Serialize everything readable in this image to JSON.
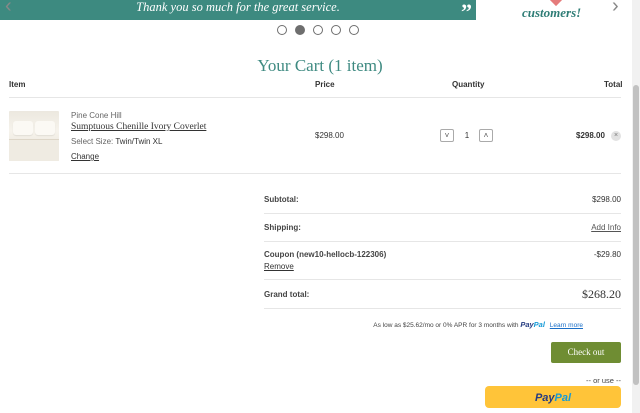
{
  "carousel": {
    "banner_text": "Thank you so much for the great service.",
    "quote_mark": "”",
    "side_text": "customers!",
    "prev_icon": "‹",
    "next_icon": "›",
    "slide_count": 5,
    "active_slide": 2
  },
  "cart": {
    "title": "Your Cart (1 item)",
    "headers": {
      "item": "Item",
      "price": "Price",
      "quantity": "Quantity",
      "total": "Total"
    },
    "item": {
      "brand": "Pine Cone Hill",
      "name": "Sumptuous Chenille Ivory Coverlet",
      "size_label": "Select Size:",
      "size_value": "Twin/Twin XL",
      "change_label": "Change",
      "price": "$298.00",
      "quantity": "1",
      "total": "$298.00",
      "minus_icon": "˅",
      "plus_icon": "˄",
      "remove_icon": "×"
    }
  },
  "summary": {
    "subtotal_label": "Subtotal:",
    "subtotal_value": "$298.00",
    "shipping_label": "Shipping:",
    "shipping_value": "Add Info",
    "coupon_label": "Coupon (new10-hellocb-122306)",
    "coupon_remove": "Remove",
    "coupon_value": "-$29.80",
    "grand_label": "Grand total:",
    "grand_value": "$268.20"
  },
  "paypal_note": {
    "text": "As low as $25.62/mo or 0% APR for 3 months with",
    "logo_pay": "Pay",
    "logo_pal": "Pal",
    "learn_more": "Learn more"
  },
  "actions": {
    "checkout_label": "Check out",
    "or_use": "-- or use --",
    "paypal_pay": "Pay",
    "paypal_pal": "Pal"
  },
  "colors": {
    "brand_teal": "#3e8a81",
    "checkout_green": "#6f8d33",
    "paypal_yellow": "#ffc439"
  }
}
